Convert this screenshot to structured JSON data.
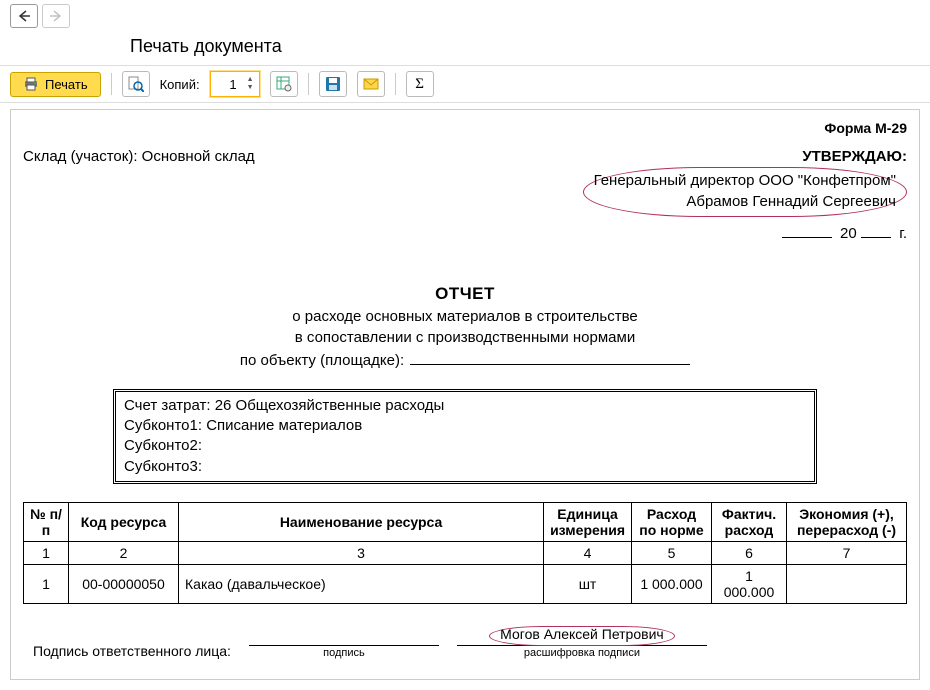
{
  "window": {
    "title": "Печать документа"
  },
  "toolbar": {
    "print_label": "Печать",
    "copies_label": "Копий:",
    "copies_value": "1"
  },
  "doc": {
    "form_number": "Форма М-29",
    "warehouse_label": "Склад (участок):",
    "warehouse_value": "Основной склад",
    "approve": {
      "title": "УТВЕРЖДАЮ:",
      "line1": "Генеральный директор ООО \"Конфетпром\"",
      "line2": "Абрамов Геннадий Сергеевич",
      "year_prefix": "20",
      "year_suffix": "г."
    },
    "report": {
      "title": "ОТЧЕТ",
      "sub1": "о расходе основных материалов в строительстве",
      "sub2": "в сопоставлении с производственными нормами",
      "object_label": "по объекту (площадке):"
    },
    "info": {
      "account_label": "Счет затрат:",
      "account_value": "26 Общехозяйственные расходы",
      "sub1_label": "Субконто1:",
      "sub1_value": "Списание материалов",
      "sub2_label": "Субконто2:",
      "sub2_value": "",
      "sub3_label": "Субконто3:",
      "sub3_value": ""
    },
    "table": {
      "headers": {
        "num": "№ п/п",
        "code": "Код ресурса",
        "name": "Наименование ресурса",
        "unit": "Единица измерения",
        "norm": "Расход по норме",
        "fact": "Фактич. расход",
        "diff": "Экономия (+), перерасход (-)"
      },
      "numrow": {
        "c1": "1",
        "c2": "2",
        "c3": "3",
        "c4": "4",
        "c5": "5",
        "c6": "6",
        "c7": "7"
      },
      "rows": [
        {
          "num": "1",
          "code": "00-00000050",
          "name": "Какао (давальческое)",
          "unit": "шт",
          "norm": "1 000.000",
          "fact": "1 000.000",
          "diff": ""
        }
      ]
    },
    "sign": {
      "label": "Подпись ответственного лица:",
      "caption1": "подпись",
      "name": "Могов Алексей Петрович",
      "caption2": "расшифровка подписи"
    }
  }
}
